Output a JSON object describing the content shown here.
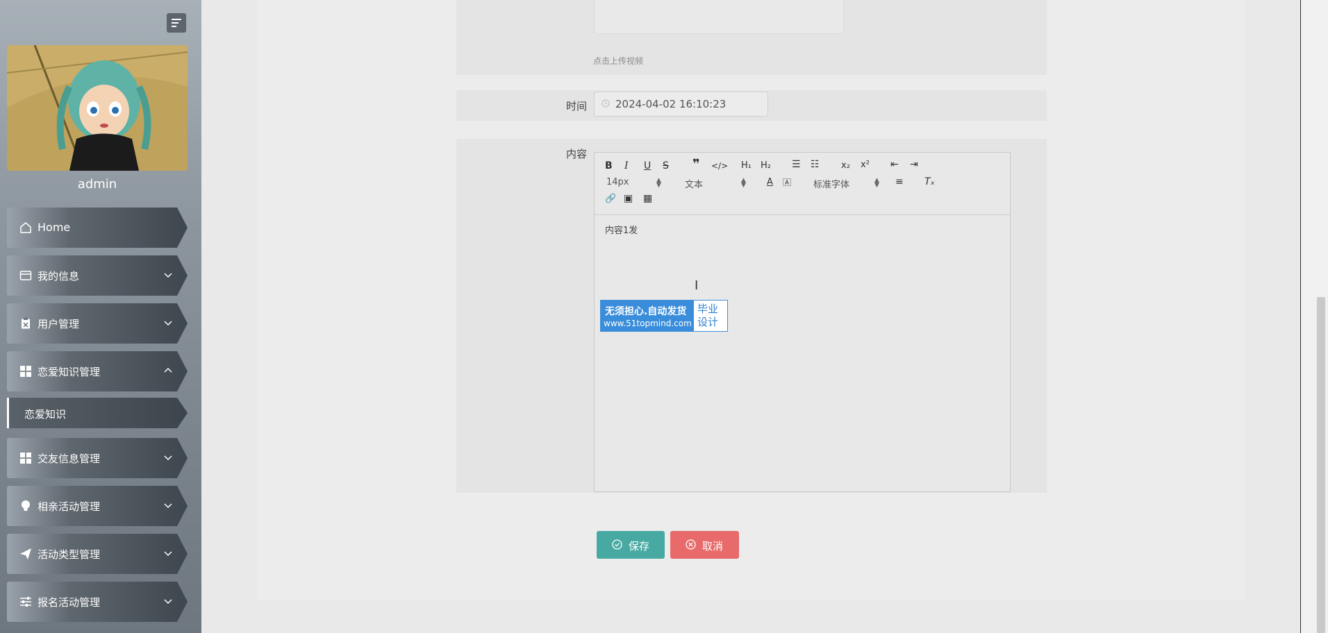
{
  "sidebar": {
    "username": "admin",
    "menu": {
      "home": "Home",
      "my_info": "我的信息",
      "user_mgmt": "用户管理",
      "love_knowledge_mgmt": "恋爱知识管理",
      "love_knowledge_sub": "恋爱知识",
      "friend_info_mgmt": "交友信息管理",
      "blind_date_mgmt": "相亲活动管理",
      "activity_type_mgmt": "活动类型管理",
      "signup_activity_mgmt": "报名活动管理"
    }
  },
  "form": {
    "upload_hint": "点击上传视频",
    "time_label": "时间",
    "time_value": "2024-04-02 16:10:23",
    "content_label": "内容",
    "editor": {
      "font_size": "14px",
      "paragraph": "文本",
      "font_family": "标准字体",
      "content": "内容1发"
    },
    "watermark": {
      "line1": "无须担心.自动发货",
      "line2": "www.51topmind.com",
      "right_line1": "毕业",
      "right_line2": "设计"
    },
    "save_label": "保存",
    "cancel_label": "取消"
  }
}
